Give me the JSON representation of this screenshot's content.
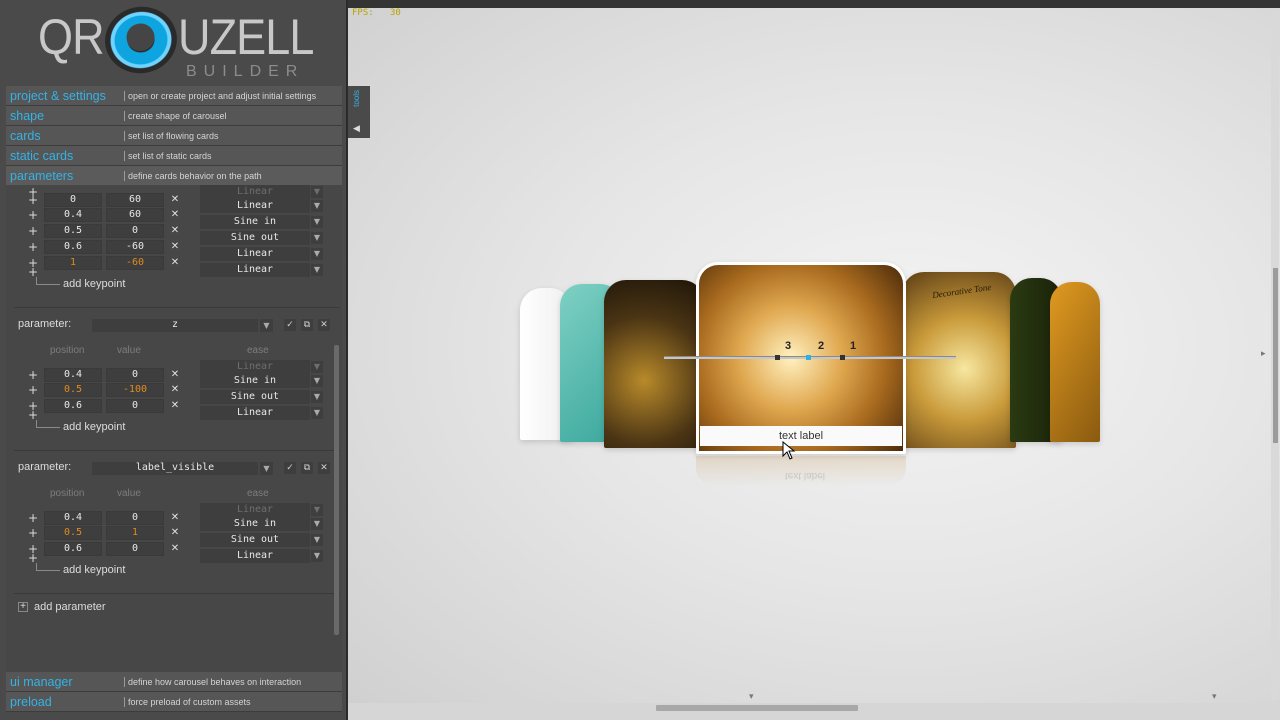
{
  "logo": {
    "left": "QR",
    "right": "UZELL",
    "sub": "BUILDER"
  },
  "menu": [
    {
      "label": "project & settings",
      "desc": "open or create project and adjust initial settings"
    },
    {
      "label": "shape",
      "desc": "create shape of carousel"
    },
    {
      "label": "cards",
      "desc": "set list of flowing cards"
    },
    {
      "label": "static cards",
      "desc": "set list of static cards"
    },
    {
      "label": "parameters",
      "desc": "define cards behavior on the path"
    }
  ],
  "bottom_menu": [
    {
      "label": "ui manager",
      "desc": "define how carousel behaves on interaction"
    },
    {
      "label": "preload",
      "desc": "force preload of custom assets"
    }
  ],
  "param_group_1": {
    "rows": [
      {
        "pos": "0",
        "val": "60",
        "ease": "Linear"
      },
      {
        "pos": "0.4",
        "val": "60",
        "ease": "Sine in"
      },
      {
        "pos": "0.5",
        "val": "0",
        "ease": "Sine out"
      },
      {
        "pos": "0.6",
        "val": "-60",
        "ease": "Linear"
      },
      {
        "pos": "1",
        "val": "-60",
        "ease": "Linear"
      }
    ],
    "hidden_ease": "Linear",
    "add_keypoint": "add keypoint"
  },
  "param_group_2": {
    "label": "parameter:",
    "name": "z",
    "col_position": "position",
    "col_value": "value",
    "col_ease": "ease",
    "hidden_ease": "Linear",
    "rows": [
      {
        "pos": "0.4",
        "val": "0",
        "ease": "Sine in"
      },
      {
        "pos": "0.5",
        "val": "-100",
        "ease": "Sine out"
      },
      {
        "pos": "0.6",
        "val": "0",
        "ease": "Linear"
      }
    ],
    "add_keypoint": "add keypoint"
  },
  "param_group_3": {
    "label": "parameter:",
    "name": "label_visible",
    "col_position": "position",
    "col_value": "value",
    "col_ease": "ease",
    "hidden_ease": "Linear",
    "rows": [
      {
        "pos": "0.4",
        "val": "0",
        "ease": "Sine in"
      },
      {
        "pos": "0.5",
        "val": "1",
        "ease": "Sine out"
      },
      {
        "pos": "0.6",
        "val": "0",
        "ease": "Linear"
      }
    ],
    "add_keypoint": "add keypoint"
  },
  "add_parameter": "add parameter",
  "preview": {
    "fps_label": "FPS:",
    "fps_value": "30",
    "side_tab": "tools",
    "text_label": "text label",
    "path_numbers": [
      "3",
      "2",
      "1"
    ],
    "card_text": "Decorative Tone"
  },
  "colors": {
    "accent": "#35b3e6",
    "orange": "#e08a20",
    "panel": "#4a4a4a"
  }
}
